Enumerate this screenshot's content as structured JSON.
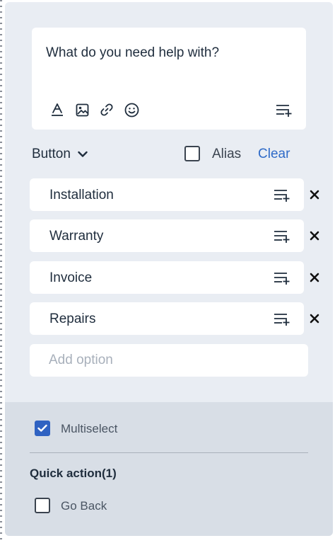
{
  "message": {
    "text": "What do you need help with?"
  },
  "toolbar": {
    "icons": [
      "text-format-icon",
      "image-icon",
      "link-icon",
      "emoji-icon",
      "list-add-icon"
    ]
  },
  "controls": {
    "type_label": "Button",
    "alias_label": "Alias",
    "alias_checked": false,
    "clear_label": "Clear"
  },
  "options": [
    {
      "label": "Installation"
    },
    {
      "label": "Warranty"
    },
    {
      "label": "Invoice"
    },
    {
      "label": "Repairs"
    }
  ],
  "add_option": {
    "placeholder": "Add option",
    "value": ""
  },
  "settings": {
    "multiselect_label": "Multiselect",
    "multiselect_checked": true,
    "quick_action_heading": "Quick action(1)",
    "go_back_label": "Go Back",
    "go_back_checked": false
  },
  "colors": {
    "panel_bg": "#e9edf3",
    "bottom_bg": "#d8dee6",
    "accent": "#2f6bc8",
    "checkbox_checked": "#2f62c2",
    "text": "#1f2d3d"
  }
}
